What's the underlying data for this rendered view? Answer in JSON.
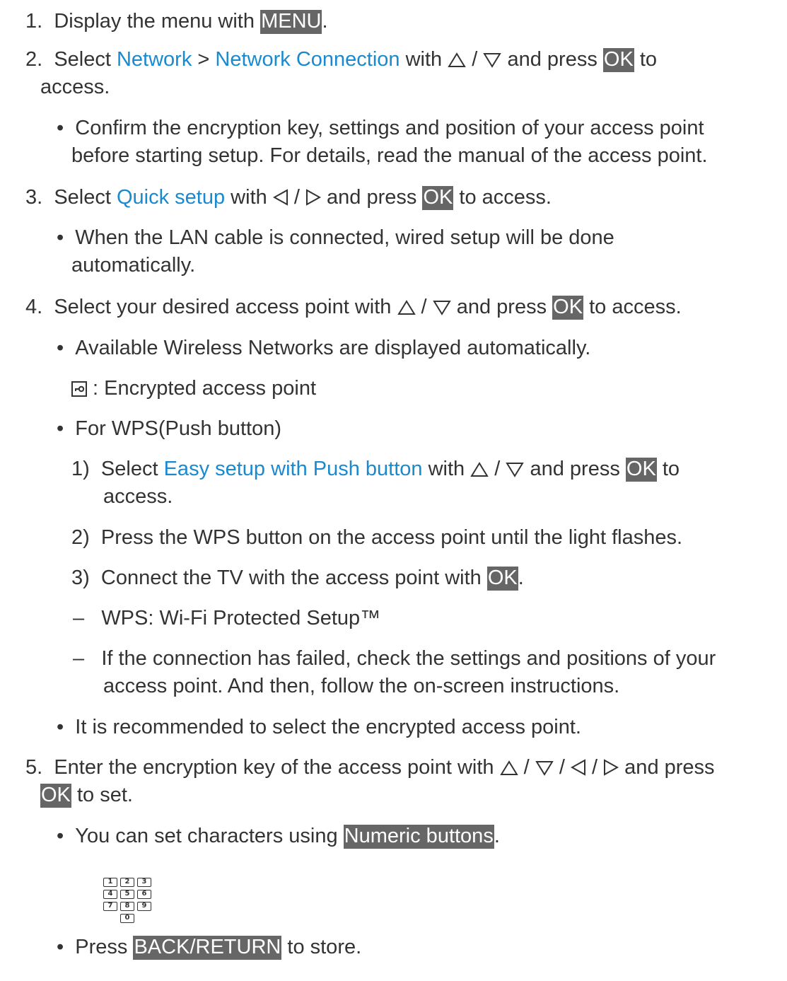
{
  "steps": {
    "s1": {
      "num": "1.",
      "pre": "Display the menu with ",
      "key": "MENU",
      "post": "."
    },
    "s2": {
      "num": "2.",
      "pre": "Select ",
      "link1": "Network",
      "sep": " > ",
      "link2": "Network Connection",
      "mid": " with ",
      "slash": " / ",
      "post1": " and press ",
      "key": "OK",
      "post2": " to",
      "cont": "access.",
      "bullet_line1": "Confirm the encryption key, settings and position of your access point",
      "bullet_line2": "before starting setup. For details, read the manual of the access point."
    },
    "s3": {
      "num": "3.",
      "pre": "Select ",
      "link": "Quick setup",
      "mid": " with ",
      "slash": " / ",
      "post1": " and press ",
      "key": "OK",
      "post2": " to access.",
      "bullet_line1": "When the LAN cable is connected, wired setup will be done",
      "bullet_line2": "automatically."
    },
    "s4": {
      "num": "4.",
      "pre": "Select your desired access point with ",
      "slash": " / ",
      "post1": " and press ",
      "key": "OK",
      "post2": " to access.",
      "b1": "Available Wireless Networks are displayed automatically.",
      "enc_note": " : Encrypted access point",
      "b2": "For WPS(Push button)",
      "sub1_num": "1)",
      "sub1_pre": "Select ",
      "sub1_link": "Easy setup with Push button",
      "sub1_mid": " with ",
      "sub1_slash": " / ",
      "sub1_post1": " and press ",
      "sub1_key": "OK",
      "sub1_post2": " to",
      "sub1_cont": "access.",
      "sub2_num": "2)",
      "sub2": "Press the WPS button on the access point until the light flashes.",
      "sub3_num": "3)",
      "sub3_pre": "Connect the TV with the access point with ",
      "sub3_key": "OK",
      "sub3_post": ".",
      "dash": "–",
      "dash1": "WPS: Wi-Fi Protected Setup™",
      "dash2_line1": "If the connection has failed, check the settings and positions of your",
      "dash2_line2": "access point. And then, follow the on-screen instructions.",
      "b3": "It is recommended to select the encrypted access point."
    },
    "s5": {
      "num": "5.",
      "pre": "Enter the encryption key of the access point with ",
      "slash": " / ",
      "post1": " and press",
      "key": "OK",
      "post2": " to set.",
      "b1_pre": "You can set characters using ",
      "b1_key": "Numeric buttons",
      "b1_post": ".",
      "numpad": [
        "1",
        "2",
        "3",
        "4",
        "5",
        "6",
        "7",
        "8",
        "9",
        "0"
      ],
      "b2_pre": "Press ",
      "b2_key": "BACK/RETURN",
      "b2_post": " to store."
    }
  },
  "bullet_char": "•",
  "colors": {
    "text": "#333333",
    "link": "#1a8ad0",
    "key_bg": "#666666",
    "key_fg": "#ffffff"
  },
  "icons": [
    "up-triangle-icon",
    "down-triangle-icon",
    "left-triangle-icon",
    "right-triangle-icon",
    "encrypted-lock-icon",
    "numeric-keypad-icon"
  ]
}
